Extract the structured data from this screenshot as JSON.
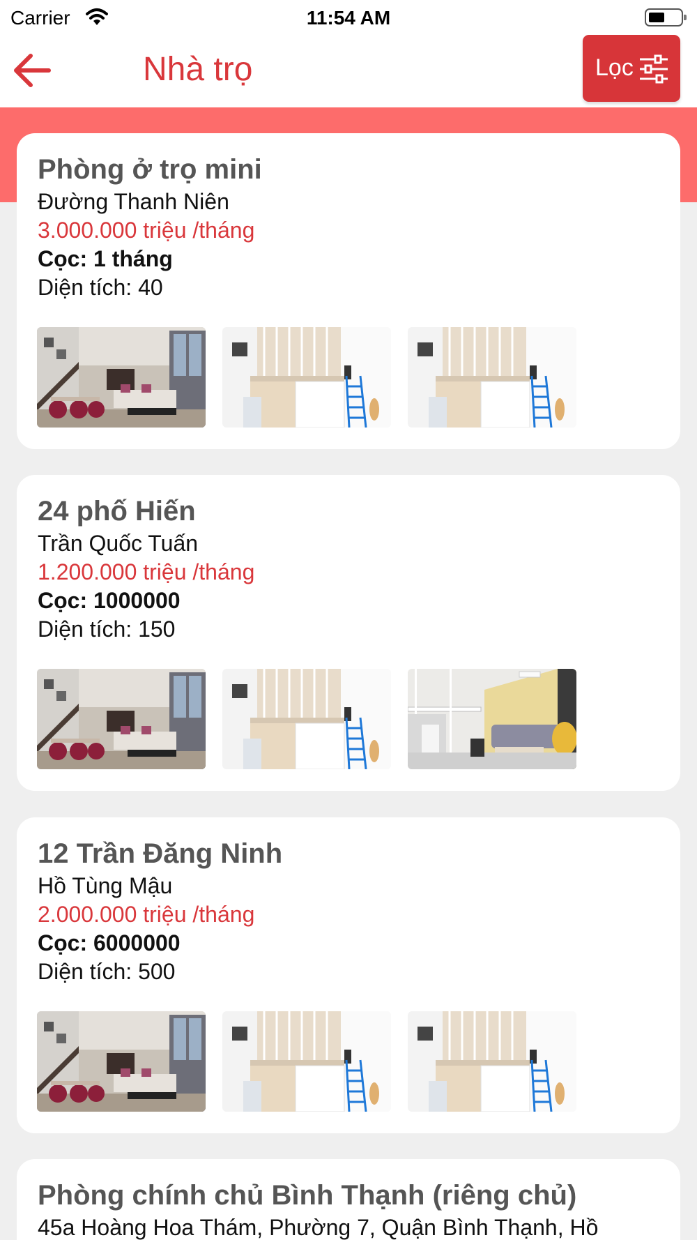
{
  "status_bar": {
    "carrier": "Carrier",
    "time": "11:54 AM"
  },
  "nav": {
    "title": "Nhà trọ",
    "filter_label": "Lọc"
  },
  "colors": {
    "accent": "#d9373b",
    "band": "#fd6c6b",
    "background": "#efefef"
  },
  "listings": [
    {
      "title": "Phòng ở trọ mini",
      "street": "Đường Thanh Niên",
      "price": "3.000.000 triệu /tháng",
      "deposit": "Cọc: 1 tháng",
      "area": "Diện tích: 40",
      "images": [
        "living-room-photo",
        "loft-bedroom-photo",
        "loft-bedroom-photo"
      ]
    },
    {
      "title": "24 phố Hiến",
      "street": "Trần Quốc Tuấn",
      "price": "1.200.000 triệu /tháng",
      "deposit": "Cọc: 1000000",
      "area": "Diện tích: 150",
      "images": [
        "living-room-photo",
        "loft-bedroom-photo",
        "loft-sofa-photo"
      ]
    },
    {
      "title": "12 Trần Đăng Ninh",
      "street": "Hồ Tùng Mậu",
      "price": "2.000.000 triệu /tháng",
      "deposit": "Cọc: 6000000",
      "area": "Diện tích: 500",
      "images": [
        "living-room-photo",
        "loft-bedroom-photo",
        "loft-bedroom-photo"
      ]
    },
    {
      "title": "Phòng chính chủ Bình Thạnh (riêng chủ)",
      "street": "45a Hoàng Hoa Thám, Phường 7, Quận Bình Thạnh, Hồ"
    }
  ]
}
